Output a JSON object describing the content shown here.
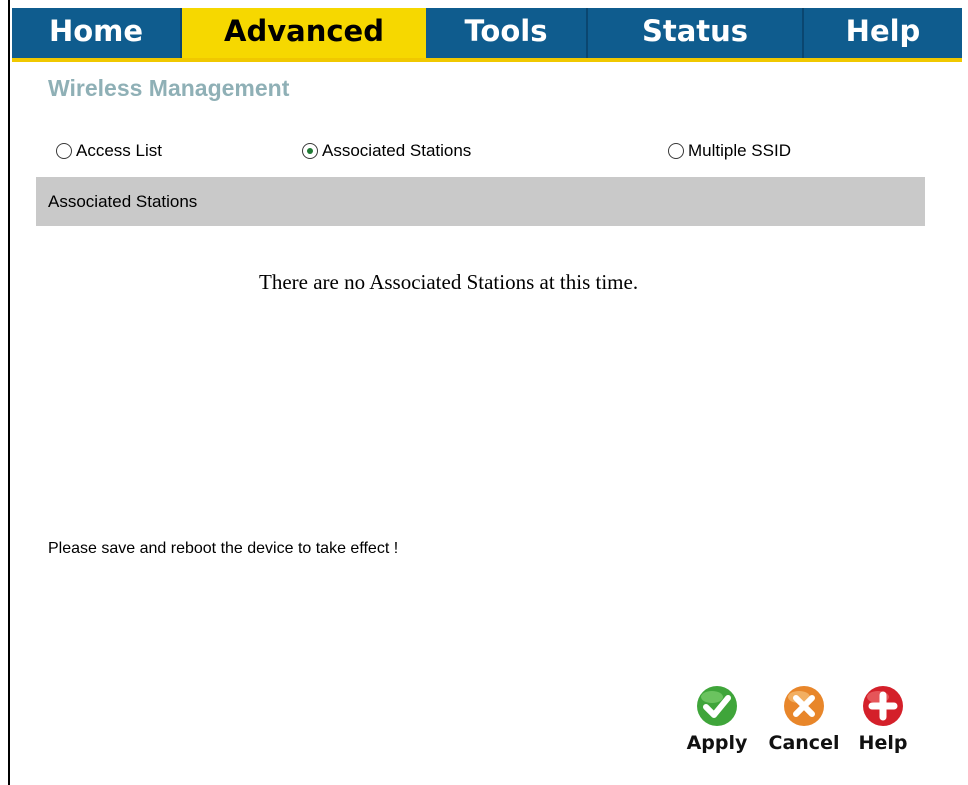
{
  "nav": {
    "tabs": [
      {
        "label": "Home",
        "active": false
      },
      {
        "label": "Advanced",
        "active": true
      },
      {
        "label": "Tools",
        "active": false
      },
      {
        "label": "Status",
        "active": false
      },
      {
        "label": "Help",
        "active": false
      }
    ]
  },
  "page": {
    "title": "Wireless Management",
    "options": [
      {
        "label": "Access List",
        "checked": false
      },
      {
        "label": "Associated Stations",
        "checked": true
      },
      {
        "label": "Multiple SSID",
        "checked": false
      }
    ],
    "section_header": "Associated Stations",
    "empty_message": "There are no Associated Stations at this time.",
    "note": "Please save and reboot the device to take effect !"
  },
  "actions": {
    "apply": {
      "label": "Apply",
      "icon": "checkmark-icon",
      "color": "#3fa53a"
    },
    "cancel": {
      "label": "Cancel",
      "icon": "x-icon",
      "color": "#e8862a"
    },
    "help": {
      "label": "Help",
      "icon": "plus-icon",
      "color": "#d4202a"
    }
  },
  "colors": {
    "nav_background": "#0f5c8e",
    "nav_active": "#f6d800",
    "nav_underline": "#f0c800",
    "title": "#8fb0b6",
    "header_bar": "#c9c9c9"
  }
}
